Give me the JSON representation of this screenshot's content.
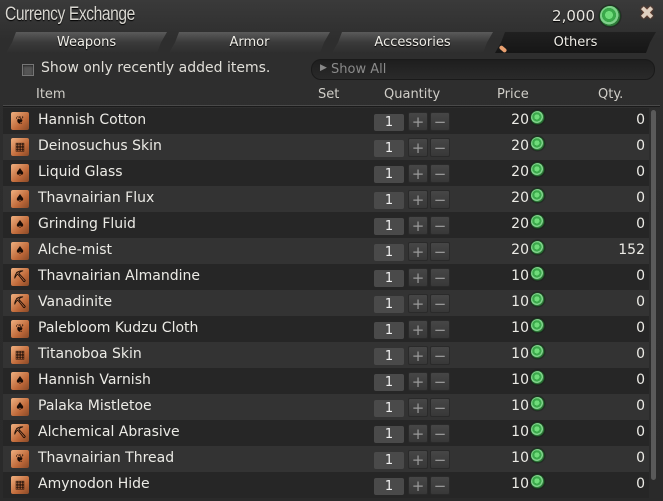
{
  "window": {
    "title": "Currency Exchange",
    "currency_amount": "2,000",
    "currency_icon": "gem-currency-icon",
    "close_icon": "close-icon"
  },
  "tabs": [
    {
      "label": "Weapons",
      "active": false
    },
    {
      "label": "Armor",
      "active": false
    },
    {
      "label": "Accessories",
      "active": false
    },
    {
      "label": "Others",
      "active": true
    }
  ],
  "filter": {
    "checkbox_label": "Show only recently added items.",
    "checkbox_checked": false,
    "dropdown_value": "Show All"
  },
  "columns": {
    "item": "Item",
    "set": "Set",
    "quantity": "Quantity",
    "price": "Price",
    "qty": "Qty."
  },
  "rows": [
    {
      "icon": "weaver-icon",
      "name": "Hannish Cotton",
      "quantity": "1",
      "price": "20",
      "owned": "0"
    },
    {
      "icon": "leatherworker-icon",
      "name": "Deinosuchus Skin",
      "quantity": "1",
      "price": "20",
      "owned": "0"
    },
    {
      "icon": "alchemist-icon",
      "name": "Liquid Glass",
      "quantity": "1",
      "price": "20",
      "owned": "0"
    },
    {
      "icon": "alchemist-icon",
      "name": "Thavnairian Flux",
      "quantity": "1",
      "price": "20",
      "owned": "0"
    },
    {
      "icon": "alchemist-icon",
      "name": "Grinding Fluid",
      "quantity": "1",
      "price": "20",
      "owned": "0"
    },
    {
      "icon": "alchemist-icon",
      "name": "Alche-mist",
      "quantity": "1",
      "price": "20",
      "owned": "152"
    },
    {
      "icon": "miner-icon",
      "name": "Thavnairian Almandine",
      "quantity": "1",
      "price": "10",
      "owned": "0"
    },
    {
      "icon": "miner-icon",
      "name": "Vanadinite",
      "quantity": "1",
      "price": "10",
      "owned": "0"
    },
    {
      "icon": "weaver-icon",
      "name": "Palebloom Kudzu Cloth",
      "quantity": "1",
      "price": "10",
      "owned": "0"
    },
    {
      "icon": "leatherworker-icon",
      "name": "Titanoboa Skin",
      "quantity": "1",
      "price": "10",
      "owned": "0"
    },
    {
      "icon": "alchemist-icon",
      "name": "Hannish Varnish",
      "quantity": "1",
      "price": "10",
      "owned": "0"
    },
    {
      "icon": "alchemist-icon",
      "name": "Palaka Mistletoe",
      "quantity": "1",
      "price": "10",
      "owned": "0"
    },
    {
      "icon": "miner-icon",
      "name": "Alchemical Abrasive",
      "quantity": "1",
      "price": "10",
      "owned": "0"
    },
    {
      "icon": "weaver-icon",
      "name": "Thavnairian Thread",
      "quantity": "1",
      "price": "10",
      "owned": "0"
    },
    {
      "icon": "leatherworker-icon",
      "name": "Amynodon Hide",
      "quantity": "1",
      "price": "10",
      "owned": "0"
    }
  ],
  "buttons": {
    "plus": "+",
    "minus": "−"
  },
  "icon_glyphs": {
    "weaver-icon": "❦",
    "leatherworker-icon": "▦",
    "alchemist-icon": "♠",
    "miner-icon": "⛏"
  }
}
